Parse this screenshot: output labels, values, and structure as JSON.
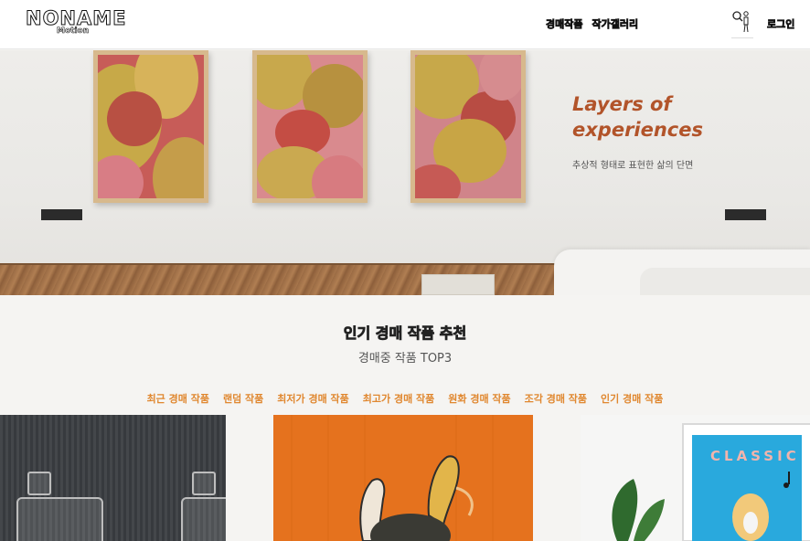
{
  "header": {
    "logo_main": "NONAME",
    "logo_sub": "Motion",
    "nav": [
      "경매작품",
      "작가갤러리"
    ],
    "login_label": "로그인"
  },
  "hero": {
    "title_line1": "Layers of",
    "title_line2": "experiences",
    "subtitle": "추상적 형태로 표현한 삶의 단면"
  },
  "section": {
    "title": "인기 경매 작품 추천",
    "subtitle": "경매중 작품 TOP3",
    "tabs": [
      "최근 경매 작품",
      "랜덤 작품",
      "최저가 경매 작품",
      "최고가 경매 작품",
      "원화 경매 작품",
      "조각 경매 작품",
      "인기 경매 작품"
    ]
  },
  "card3": {
    "poster_text": "CLASSIC"
  },
  "colors": {
    "accent": "#e0872f",
    "hero_title": "#b2542a"
  },
  "icons": {
    "search": "search-icon"
  }
}
